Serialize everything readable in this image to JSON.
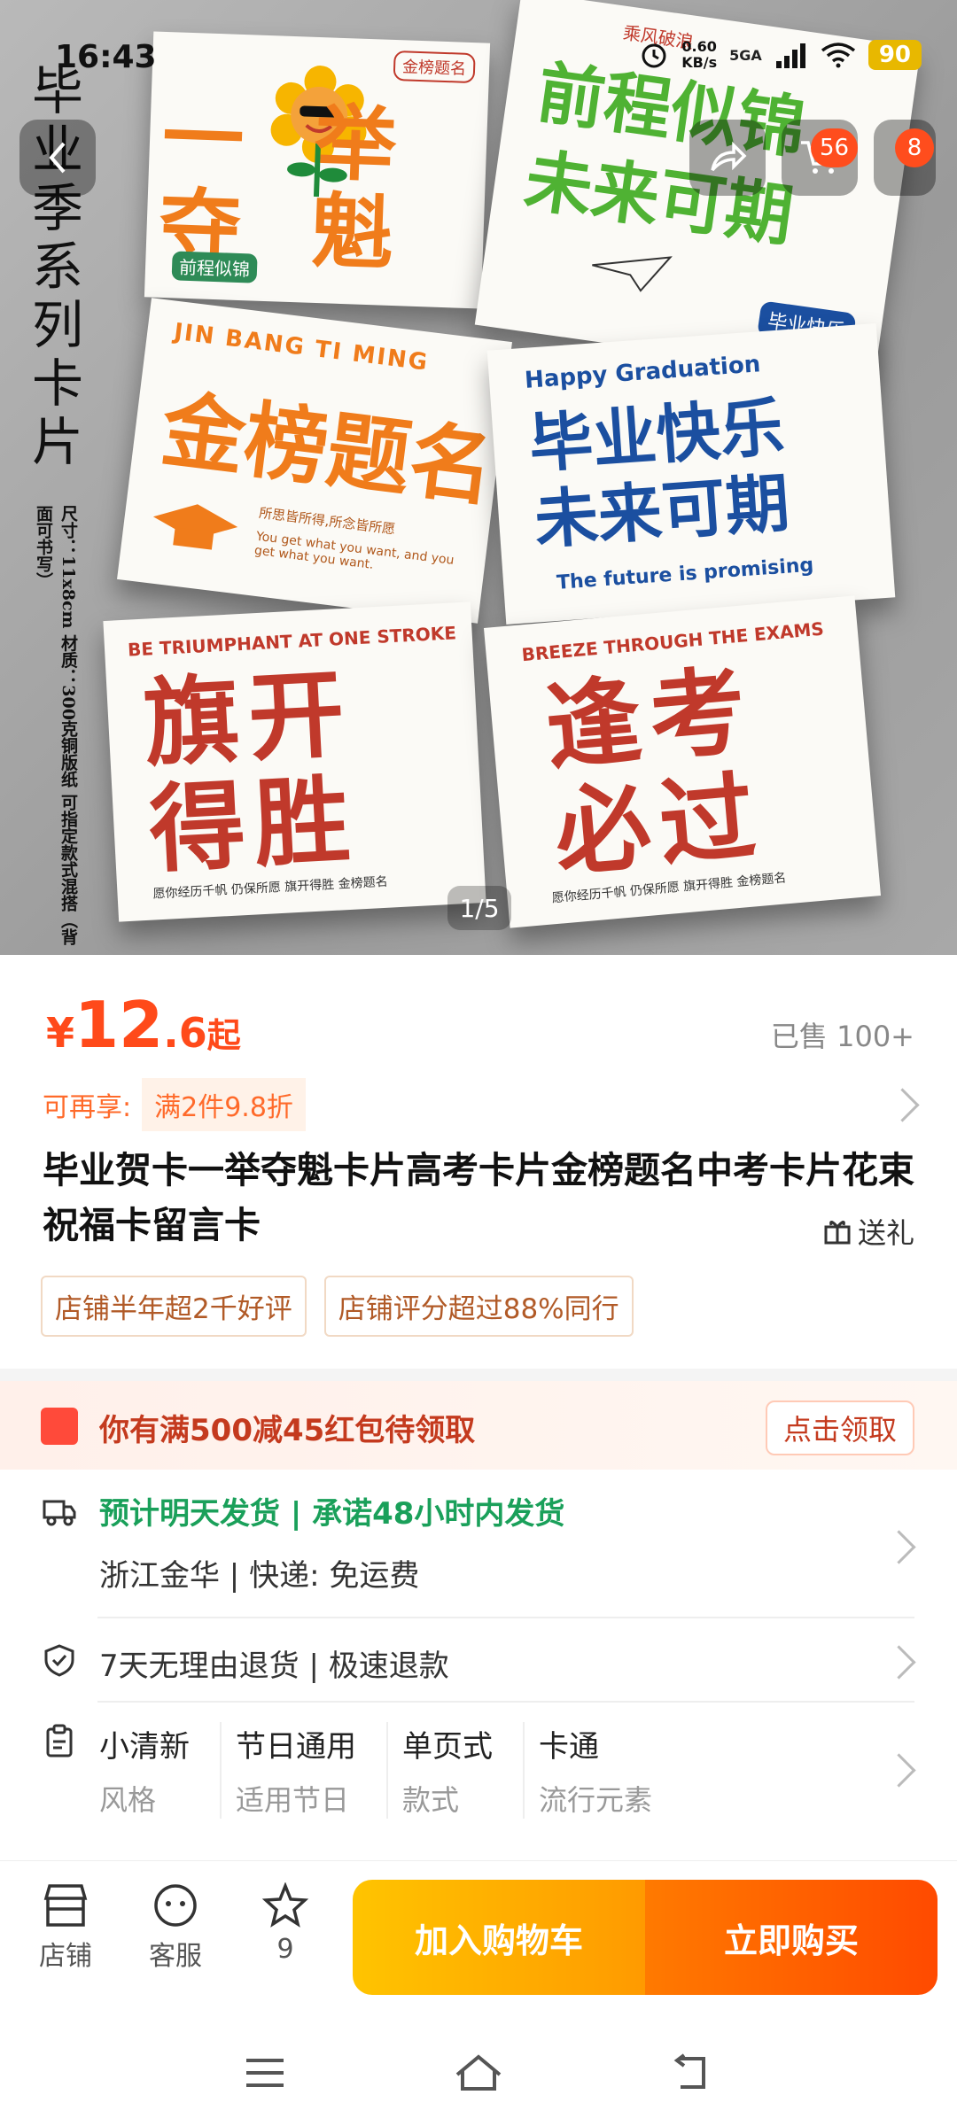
{
  "status_bar": {
    "time": "16:43",
    "net_speed_value": "0.60",
    "net_speed_unit": "KB/s",
    "network": "5GA",
    "battery": "90"
  },
  "hero": {
    "title_chars": [
      "毕",
      "业",
      "季",
      "系",
      "列",
      "卡",
      "片"
    ],
    "spec": "尺寸：11x8cm  材质：300克铜版纸  可指定款式混搭（背面可书写）",
    "cards": [
      {
        "main": "一举夺魁",
        "sub": "前程似锦",
        "stamp": "金榜题名"
      },
      {
        "main": "前程似锦 未来可期",
        "sub": "毕业快乐",
        "stamp": "乘风破浪"
      },
      {
        "main": "金榜题名",
        "sub": "JIN BANG TI MING",
        "line1": "所思皆所得,所念皆所愿",
        "line2": "You get what you want, and you get what you want."
      },
      {
        "main": "毕业快乐 未来可期",
        "sub": "Happy Graduation",
        "line1": "The future is promising"
      },
      {
        "main": "旗开得胜",
        "sub": "BE TRIUMPHANT AT ONE STROKE",
        "line1": "愿你经历千帆 仍保所愿 旗开得胜 金榜题名"
      },
      {
        "main": "逢考必过",
        "sub": "BREEZE THROUGH THE EXAMS",
        "line1": "愿你经历千帆 仍保所愿 旗开得胜 金榜题名"
      }
    ],
    "pager": "1/5"
  },
  "top_nav": {
    "cart_badge": "56",
    "menu_badge": "8"
  },
  "product": {
    "currency": "¥",
    "price_int": "12",
    "price_dec": ".6",
    "price_suffix": "起",
    "sold": "已售 100+",
    "promo_label": "可再享:",
    "promo_chip": "满2件9.8折",
    "title": "毕业贺卡一举夺魁卡片高考卡片金榜题名中考卡片花束祝福卡留言卡",
    "gift": "送礼",
    "tags": [
      "店铺半年超2千好评",
      "店铺评分超过88%同行"
    ]
  },
  "coupon": {
    "text": "你有满500减45红包待领取",
    "button": "点击领取"
  },
  "shipping": {
    "line1": "预计明天发货 | 承诺48小时内发货",
    "line2": "浙江金华 | 快递: 免运费"
  },
  "returns": {
    "text": "7天无理由退货 | 极速退款"
  },
  "attributes": [
    {
      "value": "小清新",
      "key": "风格"
    },
    {
      "value": "节日通用",
      "key": "适用节日"
    },
    {
      "value": "单页式",
      "key": "款式"
    },
    {
      "value": "卡通",
      "key": "流行元素"
    }
  ],
  "bottom_bar": {
    "shop": "店铺",
    "service": "客服",
    "favorites_count": "9",
    "add_to_cart": "加入购物车",
    "buy_now": "立即购买"
  },
  "colors": {
    "accent": "#ff4a1a",
    "green": "#1aa05a",
    "cart_gradient": "#ffc400",
    "buy_gradient": "#ff4a00"
  }
}
